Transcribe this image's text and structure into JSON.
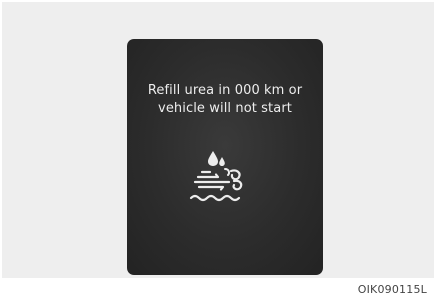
{
  "display": {
    "message_line1": "Refill urea in 000 km or",
    "message_line2": "vehicle will not start",
    "icon": "urea-fluid-warning-icon"
  },
  "caption": "OIK090115L",
  "colors": {
    "display_bg": "#2c2c2c",
    "text": "#ededed",
    "panel_bg": "#eeeeee",
    "page_bg": "#ffffff"
  }
}
